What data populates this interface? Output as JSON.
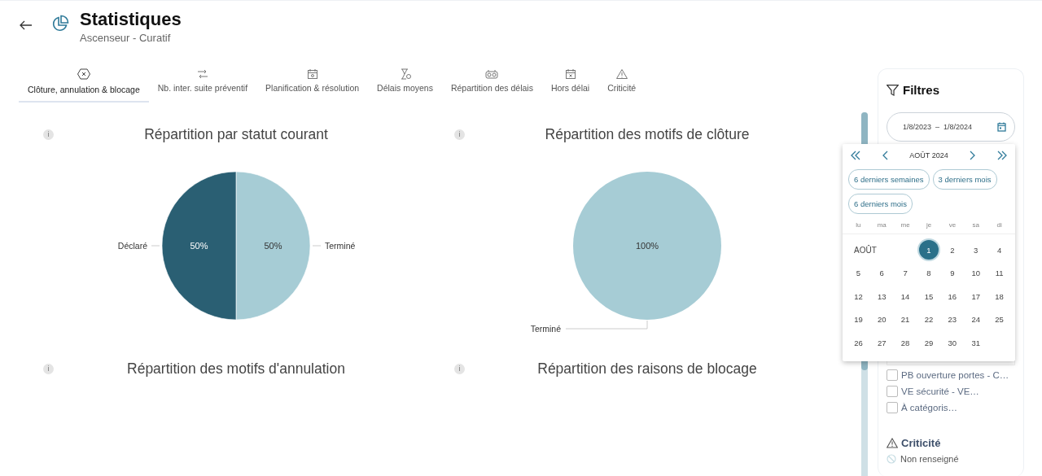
{
  "header": {
    "title": "Statistiques",
    "subtitle": "Ascenseur - Curatif"
  },
  "tabs": [
    {
      "label": "Clôture, annulation & blocage",
      "kind": "close",
      "selected": true
    },
    {
      "label": "Nb. inter. suite préventif",
      "kind": "transfer",
      "selected": false
    },
    {
      "label": "Planification & résolution",
      "kind": "calendar",
      "selected": false
    },
    {
      "label": "Délais moyens",
      "kind": "hourglass",
      "selected": false
    },
    {
      "label": "Répartition des délais",
      "kind": "gauge",
      "selected": false
    },
    {
      "label": "Hors délai",
      "kind": "calendar-x",
      "selected": false
    },
    {
      "label": "Criticité",
      "kind": "warning",
      "selected": false
    }
  ],
  "charts": [
    {
      "title": "Répartition par statut courant",
      "info": "i",
      "chart_data": {
        "type": "pie",
        "categories": [
          "Terminé",
          "Déclaré"
        ],
        "values": [
          50,
          50
        ],
        "colors": [
          "#a6ccd5",
          "#2a5f73"
        ],
        "value_labels": [
          "50%",
          "50%"
        ]
      }
    },
    {
      "title": "Répartition des motifs de clôture",
      "info": "i",
      "chart_data": {
        "type": "pie",
        "categories": [
          "Terminé"
        ],
        "values": [
          100
        ],
        "colors": [
          "#a6ccd5"
        ],
        "value_labels": [
          "100%"
        ]
      }
    },
    {
      "title": "Répartition des motifs d'annulation",
      "info": "i"
    },
    {
      "title": "Répartition des raisons de blocage",
      "info": "i"
    }
  ],
  "filters": {
    "title": "Filtres",
    "date_range": {
      "start": "1/8/2023",
      "separator": "–",
      "end": "1/8/2024"
    },
    "checkboxes": [
      {
        "label": "PB ouverture portes - C…",
        "checked": false
      },
      {
        "label": "VE sécurité - VE…",
        "checked": false
      },
      {
        "label": "À catégoris…",
        "checked": false
      }
    ],
    "criticality": {
      "title": "Criticité",
      "items": [
        "Non renseigné"
      ]
    }
  },
  "calendar": {
    "month": "AOÛT 2024",
    "presets": [
      "6 derniers semaines",
      "3 derniers mois",
      "6 derniers mois"
    ],
    "weekdays": [
      "lu",
      "ma",
      "me",
      "je",
      "ve",
      "sa",
      "di"
    ],
    "month_label": "AOÛT",
    "days": [
      {
        "label": "1",
        "selected": true
      },
      {
        "label": "2",
        "selected": false
      },
      {
        "label": "3",
        "selected": false
      },
      {
        "label": "4",
        "selected": false
      },
      {
        "label": "5",
        "selected": false
      },
      {
        "label": "6",
        "selected": false
      },
      {
        "label": "7",
        "selected": false
      },
      {
        "label": "8",
        "selected": false
      },
      {
        "label": "9",
        "selected": false
      },
      {
        "label": "10",
        "selected": false
      },
      {
        "label": "11",
        "selected": false
      },
      {
        "label": "12",
        "selected": false
      },
      {
        "label": "13",
        "selected": false
      },
      {
        "label": "14",
        "selected": false
      },
      {
        "label": "15",
        "selected": false
      },
      {
        "label": "16",
        "selected": false
      },
      {
        "label": "17",
        "selected": false
      },
      {
        "label": "18",
        "selected": false
      },
      {
        "label": "19",
        "selected": false
      },
      {
        "label": "20",
        "selected": false
      },
      {
        "label": "21",
        "selected": false
      },
      {
        "label": "22",
        "selected": false
      },
      {
        "label": "23",
        "selected": false
      },
      {
        "label": "24",
        "selected": false
      },
      {
        "label": "25",
        "selected": false
      },
      {
        "label": "26",
        "selected": false
      },
      {
        "label": "27",
        "selected": false
      },
      {
        "label": "28",
        "selected": false
      },
      {
        "label": "29",
        "selected": false
      },
      {
        "label": "30",
        "selected": false
      },
      {
        "label": "31",
        "selected": false
      }
    ]
  }
}
